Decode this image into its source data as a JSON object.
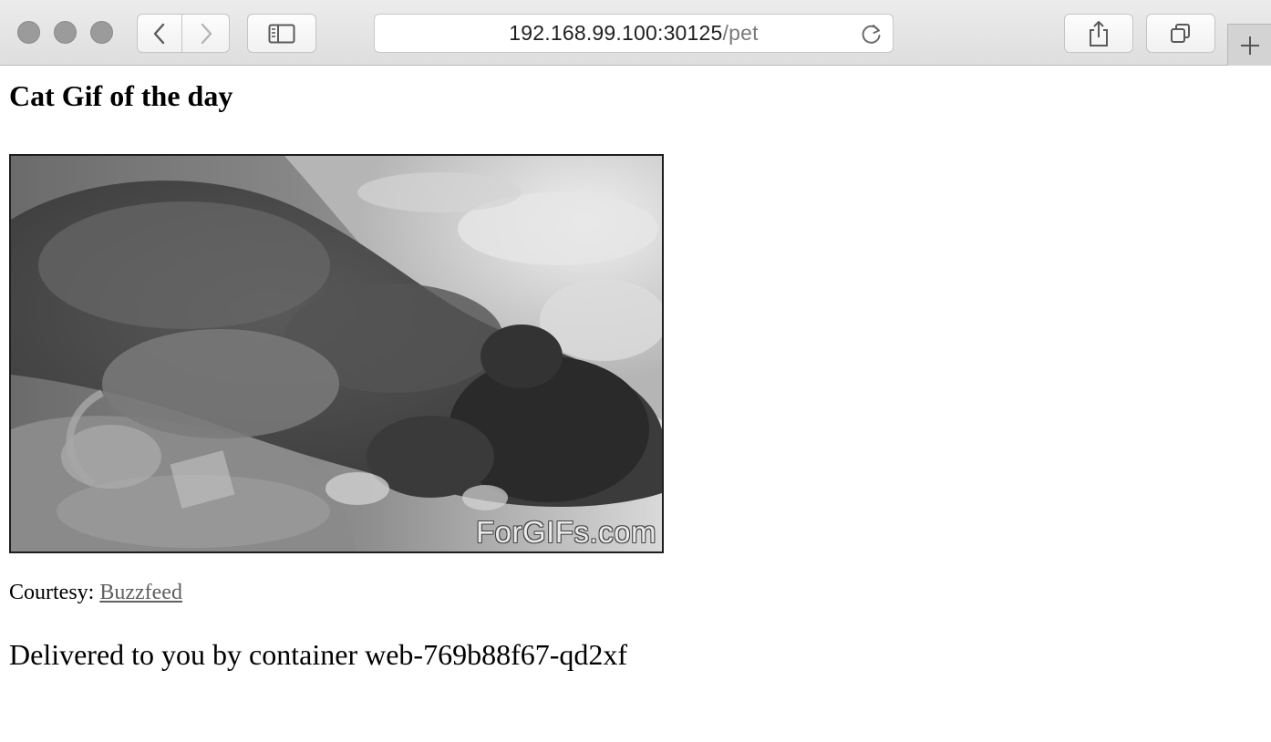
{
  "browser": {
    "url_host": "192.168.99.100:30125",
    "url_path": "/pet",
    "icons": {
      "back": "chevron-left-icon",
      "forward": "chevron-right-icon",
      "sidebar": "sidebar-icon",
      "reload": "reload-icon",
      "share": "share-icon",
      "tabs": "tabs-overview-icon",
      "new_tab": "plus-icon"
    }
  },
  "page": {
    "title": "Cat Gif of the day",
    "image_watermark": "ForGIFs.com",
    "courtesy_label": "Courtesy: ",
    "courtesy_link": "Buzzfeed",
    "delivered_text": "Delivered to you by container web-769b88f67-qd2xf"
  },
  "colors": {
    "link": "#5f5f5f",
    "toolbar": "#e4e4e4"
  }
}
